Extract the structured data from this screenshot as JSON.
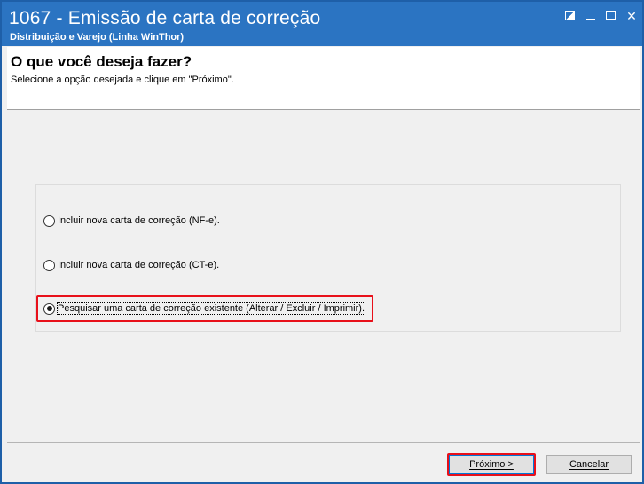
{
  "window": {
    "title": "1067 - Emissão de carta de correção",
    "subtitle": "Distribuição e Varejo (Linha WinThor)",
    "titlebar_color": "#2b74c2"
  },
  "header": {
    "heading": "O que você deseja fazer?",
    "instruction": "Selecione a opção desejada e clique em \"Próximo\"."
  },
  "options": [
    {
      "label": "Incluir nova carta de correção (NF-e).",
      "selected": false
    },
    {
      "label": "Incluir nova carta de correção (CT-e).",
      "selected": false
    },
    {
      "label": "Pesquisar uma carta de correção existente (Alterar / Excluir / Imprimir).",
      "selected": true
    }
  ],
  "buttons": {
    "next_label": "Próximo >",
    "cancel_label": "Cancelar"
  },
  "highlight_color": "#e8101a"
}
